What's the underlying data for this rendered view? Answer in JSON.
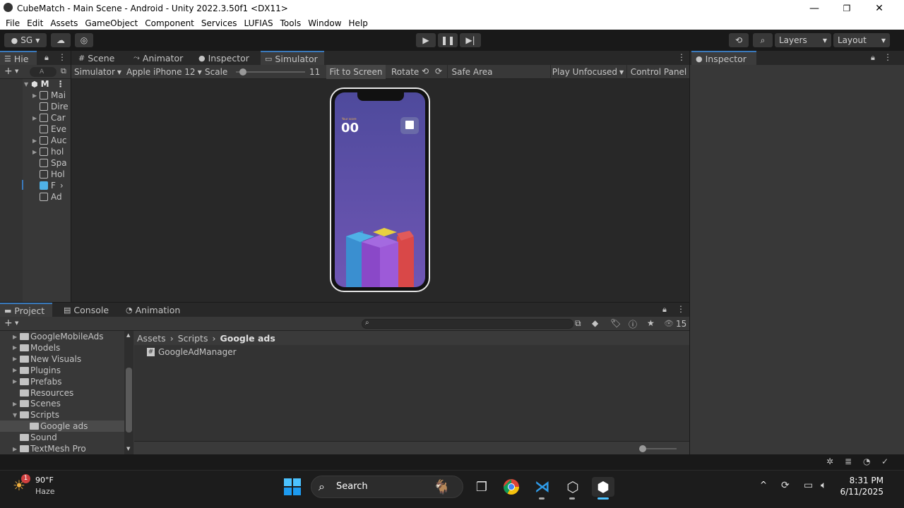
{
  "window": {
    "title": "CubeMatch - Main Scene - Android - Unity 2022.3.50f1 <DX11>",
    "minimize": "—",
    "maximize": "❐",
    "close": "✕"
  },
  "menu": [
    "File",
    "Edit",
    "Assets",
    "GameObject",
    "Component",
    "Services",
    "LUFIAS",
    "Tools",
    "Window",
    "Help"
  ],
  "toolbar": {
    "account": "SG",
    "layers": "Layers",
    "layout": "Layout"
  },
  "hierarchy": {
    "tab": "Hie",
    "search_placeholder": "A",
    "root": "M",
    "items": [
      "Mai",
      "Dire",
      "Car",
      "Eve",
      "Auc",
      "hol",
      "Spa",
      "Hol",
      "F",
      "Ad"
    ]
  },
  "center_tabs": [
    "Scene",
    "Animator",
    "Inspector",
    "Simulator"
  ],
  "simulator_toolbar": {
    "mode": "Simulator",
    "device": "Apple iPhone 12",
    "scale_label": "Scale",
    "scale_value": "11",
    "scale_fraction": 0.1,
    "fit": "Fit to Screen",
    "rotate": "Rotate",
    "safe_area": "Safe Area",
    "play_mode": "Play Unfocused",
    "control_panel": "Control Panel"
  },
  "game": {
    "label": "Your score",
    "score": "00"
  },
  "inspector": {
    "tab": "Inspector"
  },
  "bottom_tabs": [
    "Project",
    "Console",
    "Animation"
  ],
  "project": {
    "badge_count": "15",
    "folders": [
      {
        "name": "GoogleMobileAds",
        "indent": 0,
        "arrow": "▶"
      },
      {
        "name": "Models",
        "indent": 0,
        "arrow": "▶"
      },
      {
        "name": "New Visuals",
        "indent": 0,
        "arrow": "▶"
      },
      {
        "name": "Plugins",
        "indent": 0,
        "arrow": "▶"
      },
      {
        "name": "Prefabs",
        "indent": 0,
        "arrow": "▶"
      },
      {
        "name": "Resources",
        "indent": 0,
        "arrow": ""
      },
      {
        "name": "Scenes",
        "indent": 0,
        "arrow": "▶"
      },
      {
        "name": "Scripts",
        "indent": 0,
        "arrow": "▼"
      },
      {
        "name": "Google ads",
        "indent": 1,
        "arrow": ""
      },
      {
        "name": "Sound",
        "indent": 0,
        "arrow": ""
      },
      {
        "name": "TextMesh Pro",
        "indent": 0,
        "arrow": "▶"
      }
    ],
    "breadcrumb": [
      "Assets",
      "Scripts",
      "Google ads"
    ],
    "files": [
      "GoogleAdManager"
    ]
  },
  "taskbar": {
    "weather_temp": "90°F",
    "weather_desc": "Haze",
    "weather_badge": "1",
    "search": "Search",
    "time": "8:31 PM",
    "date": "6/11/2025"
  },
  "colors": {
    "accent": "#3a79bb",
    "phone_bg_top": "#5b4a9a",
    "phone_bg_bottom": "#7a5ab8"
  }
}
